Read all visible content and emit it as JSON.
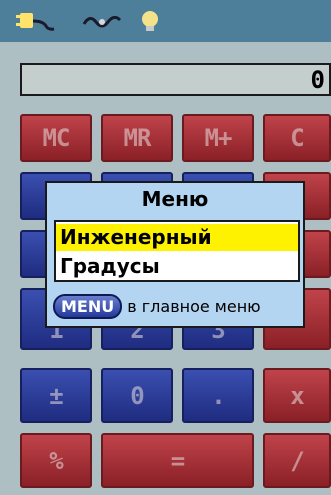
{
  "status": {
    "icons": [
      "power-plug-icon",
      "power-cable-icon",
      "backlight-icon"
    ]
  },
  "display": {
    "value": "0"
  },
  "keys": {
    "mc": "MC",
    "mr": "MR",
    "mplus": "M+",
    "c": "C",
    "one": "1",
    "two": "2",
    "three": "3",
    "plusminus": "±",
    "zero": "0",
    "dot": ".",
    "multiply": "x",
    "percent": "%",
    "equals": "=",
    "divide": "/"
  },
  "menu": {
    "title": "Меню",
    "items": [
      "Инженерный",
      "Градусы"
    ],
    "selected_index": 0,
    "hint_button": "MENU",
    "hint_text": "в главное меню"
  },
  "colors": {
    "status_bar": "#4d7f9b",
    "key_red": "#a8323a",
    "key_blue": "#2b3c99",
    "menu_bg": "#b4d5f2",
    "selection": "#fff200"
  }
}
